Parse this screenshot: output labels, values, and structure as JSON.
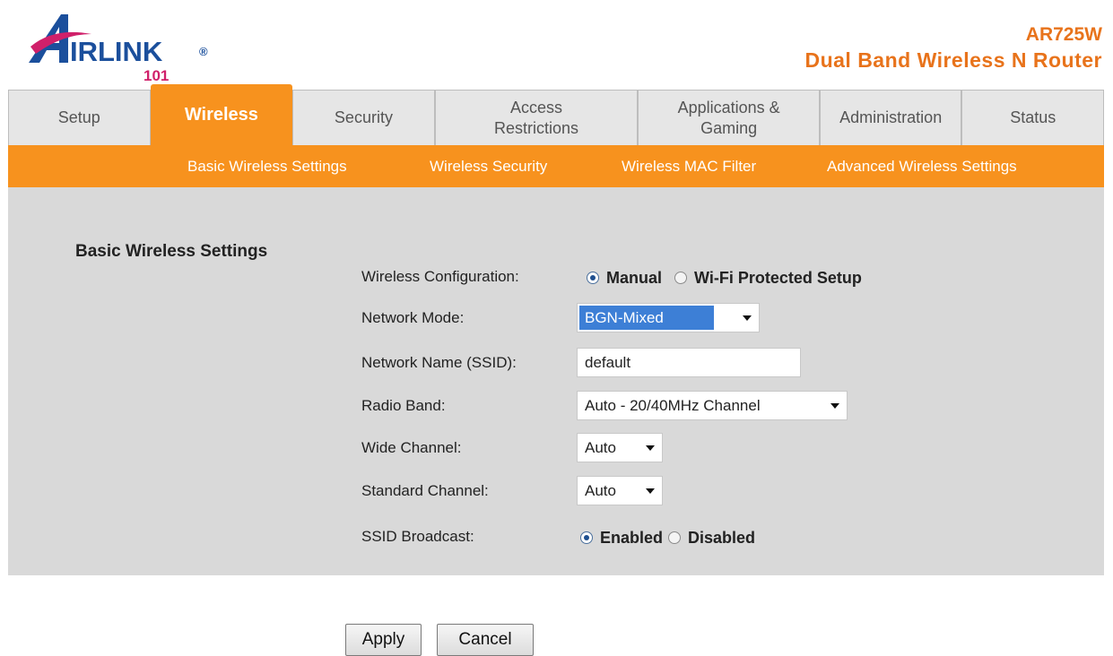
{
  "brand": {
    "logo_text": "IRLINK",
    "logo_reg": "®",
    "logo_num": "101",
    "model": "AR725W",
    "description": "Dual Band Wireless N Router",
    "colors": {
      "blue": "#1b4f9c",
      "orange": "#f7921e",
      "pink": "#d0206a"
    }
  },
  "tabs": [
    {
      "label": "Setup"
    },
    {
      "label": "Wireless",
      "active": true
    },
    {
      "label": "Security"
    },
    {
      "label": "Access Restrictions"
    },
    {
      "label": "Applications & Gaming"
    },
    {
      "label": "Administration"
    },
    {
      "label": "Status"
    }
  ],
  "subnav": [
    {
      "label": "Basic Wireless Settings"
    },
    {
      "label": "Wireless Security"
    },
    {
      "label": "Wireless MAC Filter"
    },
    {
      "label": "Advanced Wireless Settings"
    }
  ],
  "form": {
    "section_title": "Basic Wireless Settings",
    "wireless_config": {
      "label": "Wireless Configuration:",
      "options": [
        "Manual",
        "Wi-Fi Protected Setup"
      ],
      "selected": "Manual"
    },
    "network_mode": {
      "label": "Network Mode:",
      "value": "BGN-Mixed"
    },
    "ssid": {
      "label": "Network Name (SSID):",
      "value": "default"
    },
    "radio_band": {
      "label": "Radio Band:",
      "value": "Auto - 20/40MHz Channel"
    },
    "wide_channel": {
      "label": "Wide Channel:",
      "value": "Auto"
    },
    "standard_channel": {
      "label": "Standard Channel:",
      "value": "Auto"
    },
    "ssid_broadcast": {
      "label": "SSID Broadcast:",
      "options": [
        "Enabled",
        "Disabled"
      ],
      "selected": "Enabled"
    }
  },
  "buttons": {
    "apply": "Apply",
    "cancel": "Cancel"
  }
}
